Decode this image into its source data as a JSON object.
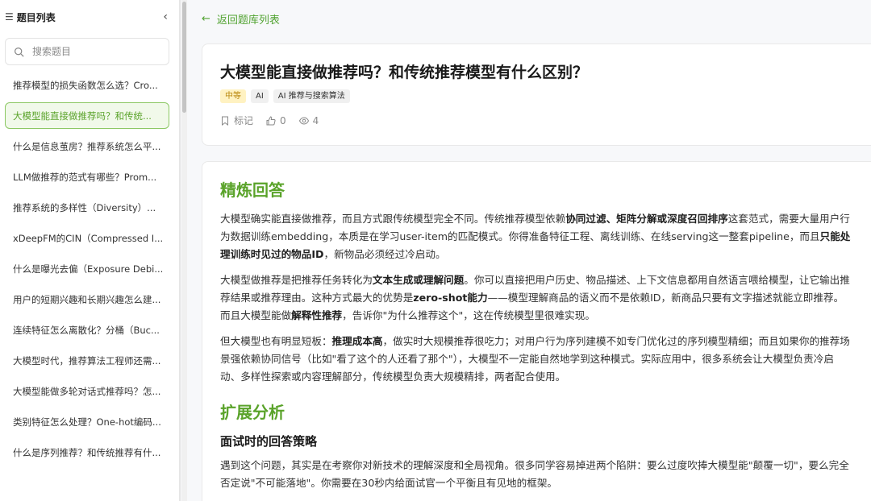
{
  "sidebar": {
    "title": "题目列表",
    "collapse_icon": "chevron-left-icon",
    "search_placeholder": "搜索题目",
    "items": [
      {
        "label": "推荐模型的损失函数怎么选？Cro..."
      },
      {
        "label": "大模型能直接做推荐吗？和传统...",
        "active": true
      },
      {
        "label": "什么是信息茧房？推荐系统怎么平..."
      },
      {
        "label": "LLM做推荐的范式有哪些？Prom..."
      },
      {
        "label": "推荐系统的多样性（Diversity）..."
      },
      {
        "label": "xDeepFM的CIN（Compressed I..."
      },
      {
        "label": "什么是曝光去偏（Exposure Debi..."
      },
      {
        "label": "用户的短期兴趣和长期兴趣怎么建..."
      },
      {
        "label": "连续特征怎么离散化？分桶（Buc..."
      },
      {
        "label": "大模型时代，推荐算法工程师还需..."
      },
      {
        "label": "大模型能做多轮对话式推荐吗？怎..."
      },
      {
        "label": "类别特征怎么处理？One-hot编码..."
      },
      {
        "label": "什么是序列推荐？和传统推荐有什..."
      }
    ]
  },
  "back_label": "返回题库列表",
  "question": {
    "title": "大模型能直接做推荐吗？和传统推荐模型有什么区别？",
    "tags": [
      "中等",
      "AI",
      "AI 推荐与搜索算法"
    ],
    "bookmark_label": "标记",
    "likes": "0",
    "views": "4"
  },
  "answer": {
    "section1_title": "精炼回答",
    "p1": {
      "t1": "大模型确实能直接做推荐，而且方式跟传统模型完全不同。传统推荐模型依赖",
      "b1": "协同过滤、矩阵分解或深度召回排序",
      "t2": "这套范式，需要大量用户行为数据训练embedding，本质是在学习user-item的匹配模式。你得准备特征工程、离线训练、在线serving这一整套pipeline，而且",
      "b2": "只能处理训练时见过的物品ID",
      "t3": "，新物品必须经过冷启动。"
    },
    "p2": {
      "t1": "大模型做推荐是把推荐任务转化为",
      "b1": "文本生成或理解问题",
      "t2": "。你可以直接把用户历史、物品描述、上下文信息都用自然语言喂给模型，让它输出推荐结果或推荐理由。这种方式最大的优势是",
      "b2": "zero-shot能力",
      "t3": "——模型理解商品的语义而不是依赖ID，新商品只要有文字描述就能立即推荐。而且大模型能做",
      "b3": "解释性推荐",
      "t4": "，告诉你\"为什么推荐这个\"，这在传统模型里很难实现。"
    },
    "p3": {
      "t1": "但大模型也有明显短板：",
      "b1": "推理成本高",
      "t2": "，做实时大规模推荐很吃力；对用户行为序列建模不如专门优化过的序列模型精细；而且如果你的推荐场景强依赖协同信号（比如\"看了这个的人还看了那个\"），大模型不一定能自然地学到这种模式。实际应用中，很多系统会让大模型负责冷启动、多样性探索或内容理解部分，传统模型负责大规模精排，两者配合使用。"
    },
    "section2_title": "扩展分析",
    "sub1_title": "面试时的回答策略",
    "p4": "遇到这个问题，其实是在考察你对新技术的理解深度和全局视角。很多同学容易掉进两个陷阱：要么过度吹捧大模型能\"颠覆一切\"，要么完全否定说\"不可能落地\"。你需要在30秒内给面试官一个平衡且有见地的框架。"
  },
  "colors": {
    "accent": "#5aa32a",
    "active_bg": "#f1f9ea",
    "level_tag": "#fff2c2"
  }
}
